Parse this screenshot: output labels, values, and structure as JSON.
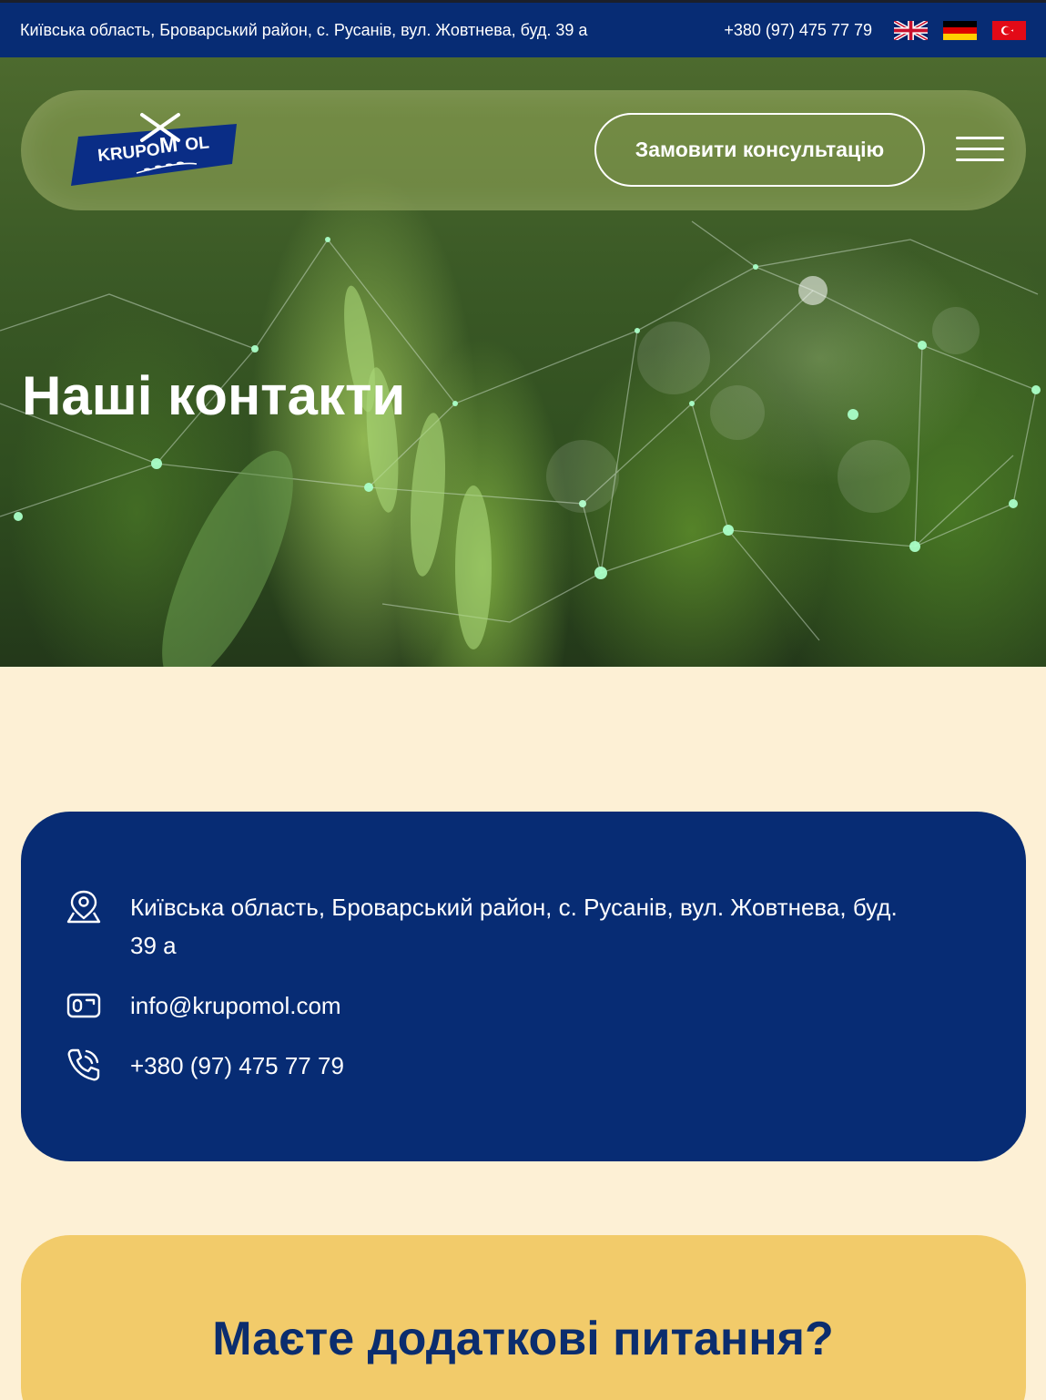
{
  "topbar": {
    "address": "Київська область, Броварський район, с. Русанів, вул. Жовтнева, буд. 39 а",
    "phone": "+380 (97) 475 77 79",
    "languages": [
      "English",
      "Deutsch",
      "Türkçe"
    ]
  },
  "header": {
    "logo_text": "KRUPOMOL",
    "consult_label": "Замовити консультацію",
    "menu_icon": "hamburger-menu-icon"
  },
  "hero": {
    "title": "Наші контакти"
  },
  "contacts": {
    "address_line1": "Київська область, Броварський район, с. Русанів, вул. Жовтнева, буд.",
    "address_line2": "39 а",
    "email": "info@krupomol.com",
    "phone": "+380 (97) 475 77 79",
    "icons": [
      "location-pin-icon",
      "email-card-icon",
      "phone-icon"
    ]
  },
  "faq": {
    "title": "Маєте додаткові питання?"
  },
  "colors": {
    "navy": "#072c74",
    "cream": "#fdf0d5",
    "yellow": "#f2cb6a",
    "title_blue": "#0b2d6e"
  }
}
